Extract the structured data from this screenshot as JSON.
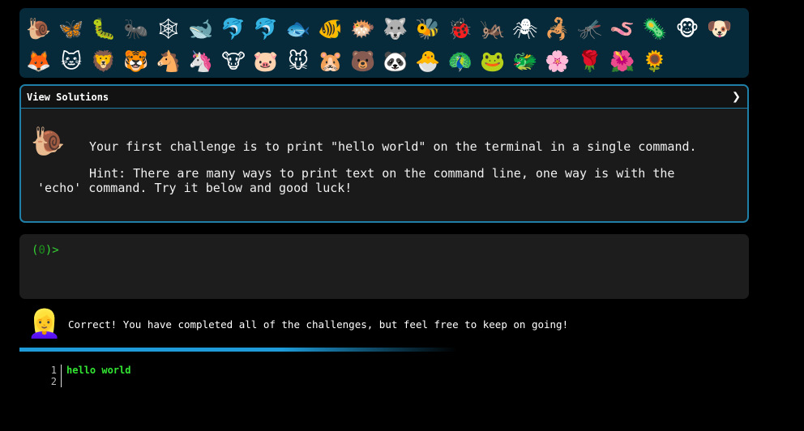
{
  "icons": {
    "row1": [
      "🐌",
      "🦋",
      "🐛",
      "🐜",
      "🕸",
      "🐋",
      "🐬",
      "🐬",
      "🐟",
      "🐠",
      "🐡",
      "🐺",
      "🐝",
      "🐞",
      "🦗",
      "🕷",
      "🦂",
      "🦟",
      "🪱",
      "🦠",
      "🐵",
      "🐶"
    ],
    "row2": [
      "🦊",
      "🐱",
      "🦁",
      "🐯",
      "🐴",
      "🦄",
      "🐮",
      "🐷",
      "🐭",
      "🐹",
      "🐻",
      "🐼",
      "🐣",
      "🦚",
      "🐸",
      "🐲",
      "🌸",
      "🌹",
      "🌺",
      "🌻"
    ]
  },
  "solutions": {
    "header": "View Solutions",
    "chevron": "❯",
    "avatar": "🐌",
    "challenge": "Your first challenge is to print \"hello world\" on the terminal in a single command.",
    "hint": "Hint: There are many ways to print text on the command line, one way is with the 'echo' command. Try it below and good luck!"
  },
  "terminal": {
    "prompt_open": "(",
    "prompt_zero": "0",
    "prompt_close": ")>"
  },
  "feedback": {
    "avatar": "👱‍♀️",
    "message": "Correct! You have completed all of the challenges, but feel free to keep on going!"
  },
  "progress": {
    "fraction": 1.0,
    "color": "#1e9bd8"
  },
  "editor": {
    "lines": [
      {
        "no": "1",
        "code": "hello world"
      },
      {
        "no": "2",
        "code": ""
      }
    ]
  }
}
